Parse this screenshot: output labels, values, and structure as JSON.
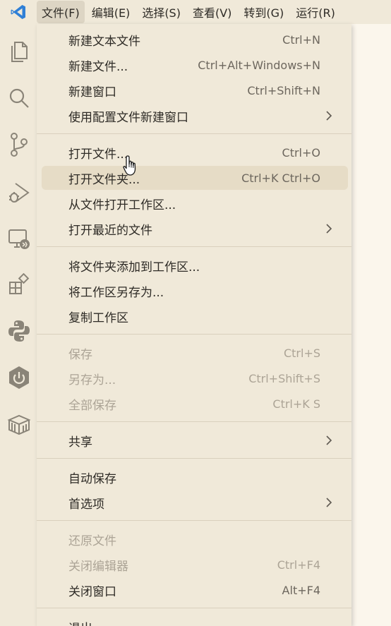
{
  "menubar": {
    "items": [
      {
        "label": "文件(F)",
        "active": true
      },
      {
        "label": "编辑(E)"
      },
      {
        "label": "选择(S)"
      },
      {
        "label": "查看(V)"
      },
      {
        "label": "转到(G)"
      },
      {
        "label": "运行(R)"
      }
    ]
  },
  "activity_bar": {
    "icons": [
      "files-icon",
      "search-icon",
      "source-control-icon",
      "run-debug-icon",
      "remote-explorer-icon",
      "extensions-icon",
      "python-icon",
      "power-icon",
      "container-icon"
    ]
  },
  "file_menu": {
    "groups": [
      [
        {
          "label": "新建文本文件",
          "shortcut": "Ctrl+N"
        },
        {
          "label": "新建文件...",
          "shortcut": "Ctrl+Alt+Windows+N"
        },
        {
          "label": "新建窗口",
          "shortcut": "Ctrl+Shift+N"
        },
        {
          "label": "使用配置文件新建窗口",
          "submenu": true
        }
      ],
      [
        {
          "label": "打开文件...",
          "shortcut": "Ctrl+O"
        },
        {
          "label": "打开文件夹...",
          "shortcut": "Ctrl+K Ctrl+O",
          "hover": true
        },
        {
          "label": "从文件打开工作区..."
        },
        {
          "label": "打开最近的文件",
          "submenu": true
        }
      ],
      [
        {
          "label": "将文件夹添加到工作区..."
        },
        {
          "label": "将工作区另存为..."
        },
        {
          "label": "复制工作区"
        }
      ],
      [
        {
          "label": "保存",
          "shortcut": "Ctrl+S",
          "disabled": true
        },
        {
          "label": "另存为...",
          "shortcut": "Ctrl+Shift+S",
          "disabled": true
        },
        {
          "label": "全部保存",
          "shortcut": "Ctrl+K S",
          "disabled": true
        }
      ],
      [
        {
          "label": "共享",
          "submenu": true
        }
      ],
      [
        {
          "label": "自动保存"
        },
        {
          "label": "首选项",
          "submenu": true
        }
      ],
      [
        {
          "label": "还原文件",
          "disabled": true
        },
        {
          "label": "关闭编辑器",
          "shortcut": "Ctrl+F4",
          "disabled": true
        },
        {
          "label": "关闭窗口",
          "shortcut": "Alt+F4"
        }
      ],
      [
        {
          "label": "退出"
        }
      ]
    ]
  },
  "colors": {
    "accent": "#2f7fd6",
    "menu_bg": "#f0e9d9",
    "hover_bg": "#e6dcc6",
    "icon": "#8a8478"
  }
}
